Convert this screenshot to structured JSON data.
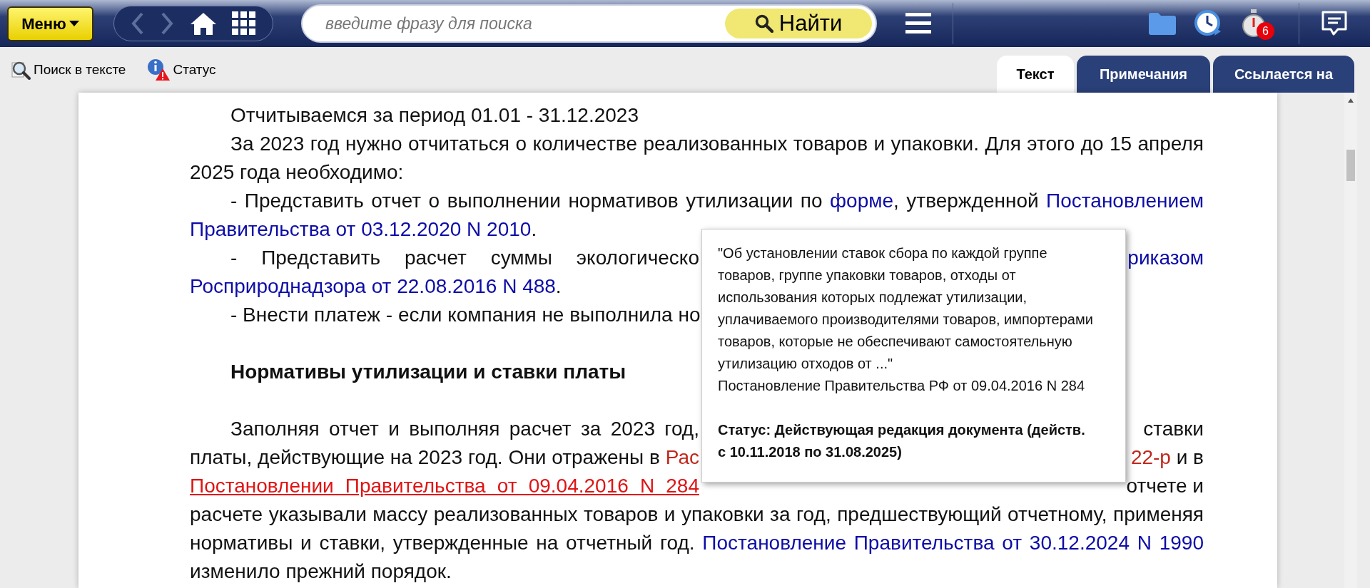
{
  "header": {
    "menu_button": "Меню",
    "navigation": {
      "back": {
        "disabled": true
      },
      "forward": {
        "disabled": true
      }
    },
    "search": {
      "placeholder": "введите фразу для поиска"
    },
    "search_button": "Найти",
    "timer_badge": "6"
  },
  "toolbar": {
    "items": [
      {
        "kind": "search",
        "label": "Поиск в тексте"
      },
      {
        "kind": "status",
        "label": "Статус"
      }
    ]
  },
  "tabs": [
    {
      "label": "Текст",
      "selected": true
    },
    {
      "label": "Примечания",
      "selected": false
    },
    {
      "label": "Ссылается на",
      "selected": false
    }
  ],
  "document": {
    "sections": [
      {
        "kind": "body",
        "paragraphs": [
          {
            "lines": [
              {
                "covered": false,
                "segments": [
                  {
                    "kind": "text",
                    "text": "Отчитываемся за период 01.01 - 31.12.2023"
                  }
                ]
              }
            ]
          },
          {
            "lines": [
              {
                "covered": false,
                "segments": [
                  {
                    "kind": "text",
                    "text": "За 2023 год нужно отчитаться о количестве реализованных товаров и упаковки. Для этого до 15 апреля"
                  }
                ]
              },
              {
                "covered": false,
                "segments": [
                  {
                    "kind": "text",
                    "text": "2025 года необходимо:"
                  }
                ]
              }
            ]
          },
          {
            "lines": [
              {
                "covered": false,
                "segments": [
                  {
                    "kind": "text",
                    "text": "- Представить отчет о выполнении нормативов утилизации по "
                  },
                  {
                    "kind": "link",
                    "text": "форме",
                    "color": "#0c0ca8",
                    "hovered": false
                  },
                  {
                    "kind": "text",
                    "text": ", утвержденной "
                  },
                  {
                    "kind": "link",
                    "text": "Постановлением",
                    "color": "#0c0ca8",
                    "hovered": false
                  }
                ]
              },
              {
                "covered": false,
                "segments": [
                  {
                    "kind": "link",
                    "text": "Правительства от 03.12.2020 N 2010",
                    "color": "#0c0ca8",
                    "hovered": false
                  },
                  {
                    "kind": "text",
                    "text": "."
                  }
                ]
              }
            ]
          },
          {
            "lines": [
              {
                "covered": true,
                "segments": [
                  {
                    "kind": "text",
                    "text": "- Представить расчет суммы экологическо"
                  }
                ],
                "right": [
                  {
                    "kind": "link",
                    "text": "риказом",
                    "color": "#0c0ca8",
                    "hovered": false
                  }
                ]
              },
              {
                "covered": false,
                "segments": [
                  {
                    "kind": "link",
                    "text": "Росприроднадзора от 22.08.2016 N 488",
                    "color": "#0c0ca8",
                    "hovered": false
                  },
                  {
                    "kind": "text",
                    "text": "."
                  }
                ]
              }
            ]
          },
          {
            "lines": [
              {
                "covered": true,
                "segments": [
                  {
                    "kind": "text",
                    "text": "- Внести платеж - если компания не выполнила но"
                  }
                ]
              }
            ]
          }
        ]
      },
      {
        "kind": "heading",
        "paragraphs": [
          {
            "lines": [
              {
                "segments": [
                  {
                    "kind": "text",
                    "text": "Нормативы утилизации и ставки платы"
                  }
                ]
              }
            ]
          }
        ]
      },
      {
        "kind": "body",
        "paragraphs": [
          {
            "lines": [
              {
                "covered": true,
                "segments": [
                  {
                    "kind": "text",
                    "text": "Заполняя отчет и выполняя расчет за 2023 год,"
                  }
                ],
                "right": [
                  {
                    "kind": "text",
                    "text": "ставки"
                  }
                ]
              },
              {
                "covered": true,
                "segments": [
                  {
                    "kind": "text",
                    "text": "платы, действующие на 2023 год. Они отражены в "
                  },
                  {
                    "kind": "link",
                    "text": "Рас",
                    "color": "#c0281c",
                    "hovered": false
                  }
                ],
                "right": [
                  {
                    "kind": "link",
                    "text": "22-р",
                    "color": "#c0281c",
                    "hovered": false
                  },
                  {
                    "kind": "text",
                    "text": " и в"
                  }
                ]
              },
              {
                "covered": true,
                "segments": [
                  {
                    "kind": "link",
                    "text": "Постановлении Правительства от 09.04.2016 N 284",
                    "color": "#e01414",
                    "hovered": true
                  }
                ],
                "right": [
                  {
                    "kind": "text",
                    "text": "отчете и"
                  }
                ]
              },
              {
                "covered": false,
                "segments": [
                  {
                    "kind": "text",
                    "text": "расчете указывали массу реализованных товаров и упаковки за год, предшествующий отчетному, применяя"
                  }
                ]
              },
              {
                "covered": false,
                "segments": [
                  {
                    "kind": "text",
                    "text": "нормативы и ставки, утвержденные на отчетный год. "
                  },
                  {
                    "kind": "link",
                    "text": "Постановление Правительства от 30.12.2024 N 1990",
                    "color": "#0c0ca8",
                    "hovered": false
                  }
                ]
              },
              {
                "covered": false,
                "segments": [
                  {
                    "kind": "text",
                    "text": "изменило прежний порядок."
                  }
                ]
              }
            ]
          }
        ]
      }
    ]
  },
  "tooltip": {
    "quote": "\"Об установлении ставок сбора по каждой группе товаров, группе упаковки товаров, отходы от использования которых подлежат утилизации, уплачиваемого производителями товаров, импортерами товаров, которые не обеспечивают самостоятельную утилизацию отходов от ...\"",
    "document": "Постановление Правительства РФ от 09.04.2016 N 284",
    "status": "Статус: Действующая редакция документа (действ. с 10.11.2018 по 31.08.2025)"
  }
}
